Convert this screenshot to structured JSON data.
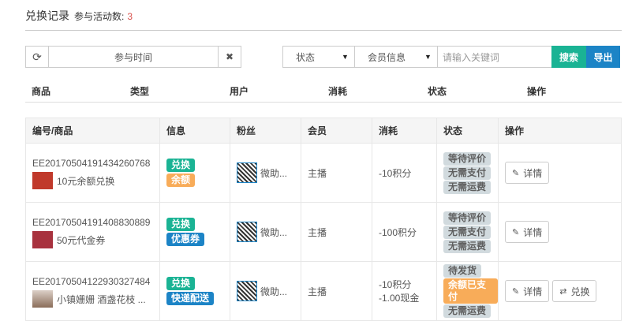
{
  "header": {
    "title": "兑换记录",
    "sub_label": "参与活动数:",
    "count": "3"
  },
  "filters": {
    "refresh_icon": "refresh-icon",
    "time_label": "参与时间",
    "clear_icon": "close-icon",
    "status_label": "状态",
    "member_label": "会员信息",
    "keyword_placeholder": "请输入关键词",
    "search_label": "搜索",
    "export_label": "导出"
  },
  "colhead": [
    "商品",
    "类型",
    "用户",
    "消耗",
    "状态",
    "操作"
  ],
  "table": {
    "headers": [
      "编号/商品",
      "信息",
      "粉丝",
      "会员",
      "消耗",
      "状态",
      "操作"
    ],
    "rows": [
      {
        "order": "EE20170504191434260768",
        "goods": "10元余额兑换",
        "tags": [
          {
            "t": "兑换",
            "c": "green"
          },
          {
            "t": "余额",
            "c": "orange"
          }
        ],
        "fan": "微助...",
        "member": "主播",
        "cost": [
          "-10积分"
        ],
        "status": [
          {
            "t": "等待评价",
            "c": "gray"
          },
          {
            "t": "无需支付",
            "c": "gray"
          },
          {
            "t": "无需运费",
            "c": "gray"
          }
        ],
        "ops": [
          "详情"
        ]
      },
      {
        "order": "EE20170504191408830889",
        "goods": "50元代金券",
        "tags": [
          {
            "t": "兑换",
            "c": "green"
          },
          {
            "t": "优惠券",
            "c": "blue"
          }
        ],
        "fan": "微助...",
        "member": "主播",
        "cost": [
          "-100积分"
        ],
        "status": [
          {
            "t": "等待评价",
            "c": "gray"
          },
          {
            "t": "无需支付",
            "c": "gray"
          },
          {
            "t": "无需运费",
            "c": "gray"
          }
        ],
        "ops": [
          "详情"
        ]
      },
      {
        "order": "EE20170504122930327484",
        "goods": "小镇姗姗 酒盏花枝 ...",
        "tags": [
          {
            "t": "兑换",
            "c": "green"
          },
          {
            "t": "快递配送",
            "c": "blue"
          }
        ],
        "fan": "微助...",
        "member": "主播",
        "cost": [
          "-10积分",
          "-1.00现金"
        ],
        "status": [
          {
            "t": "待发货",
            "c": "gray"
          },
          {
            "t": "余额已支付",
            "c": "orange"
          },
          {
            "t": "无需运费",
            "c": "gray"
          }
        ],
        "ops": [
          "详情",
          "兑换"
        ]
      }
    ]
  },
  "colors": {
    "accent": "#1ab394",
    "primary": "#1c84c6",
    "warning": "#f8ac59",
    "danger": "#d9534f"
  }
}
